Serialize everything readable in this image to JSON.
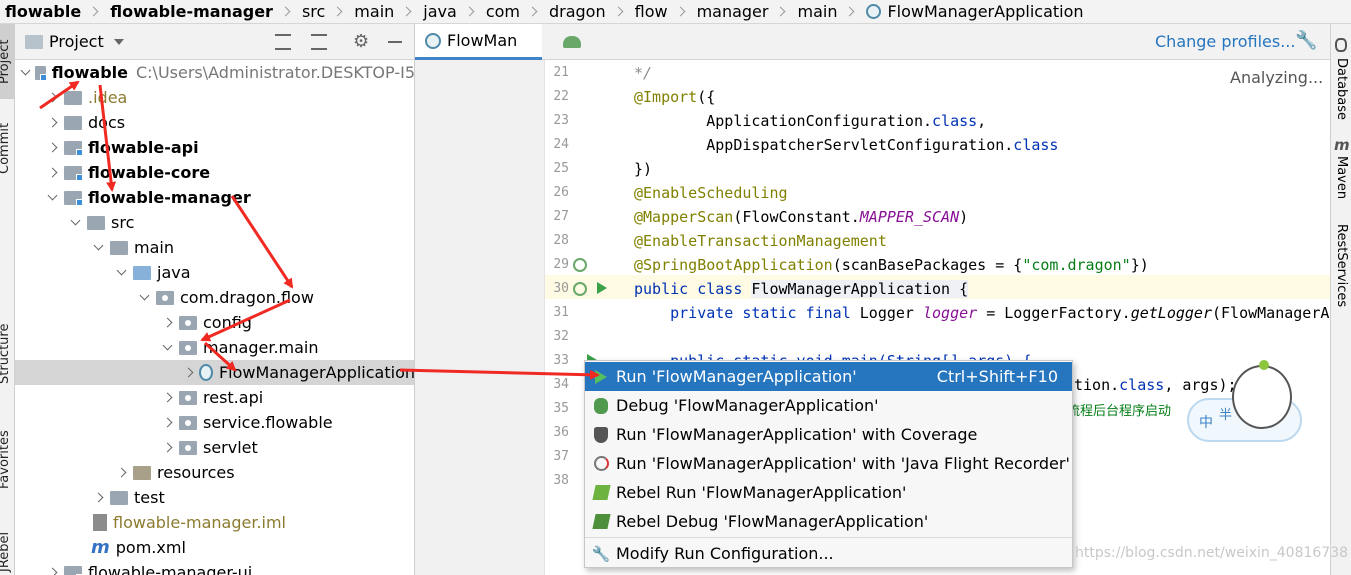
{
  "breadcrumbs": [
    "flowable",
    "flowable-manager",
    "src",
    "main",
    "java",
    "com",
    "dragon",
    "flow",
    "manager",
    "main",
    "FlowManagerApplication"
  ],
  "left_strip": [
    "Project",
    "Commit",
    "Structure",
    "Favorites",
    "JRebel"
  ],
  "right_strip": [
    "Database",
    "Maven",
    "RestServices"
  ],
  "project_panel": {
    "title": "Project",
    "tree": [
      {
        "label": "flowable",
        "hint": "C:\\Users\\Administrator.DESKTOP-I5"
      },
      {
        "label": ".idea"
      },
      {
        "label": "docs"
      },
      {
        "label": "flowable-api"
      },
      {
        "label": "flowable-core"
      },
      {
        "label": "flowable-manager"
      },
      {
        "label": "src"
      },
      {
        "label": "main"
      },
      {
        "label": "java"
      },
      {
        "label": "com.dragon.flow"
      },
      {
        "label": "config"
      },
      {
        "label": "manager.main"
      },
      {
        "label": "FlowManagerApplication"
      },
      {
        "label": "rest.api"
      },
      {
        "label": "service.flowable"
      },
      {
        "label": "servlet"
      },
      {
        "label": "resources"
      },
      {
        "label": "test"
      },
      {
        "label": "flowable-manager.iml"
      },
      {
        "label": "pom.xml"
      },
      {
        "label": "flowable-manager-ui"
      }
    ]
  },
  "editor": {
    "tab": "FlowMan",
    "change_profiles": "Change profiles...",
    "analyzing": "Analyzing...",
    "line_numbers": [
      "21",
      "22",
      "23",
      "24",
      "25",
      "26",
      "27",
      "28",
      "29",
      "30",
      "31",
      "32",
      "33",
      "34",
      "35",
      "36",
      "37",
      "38"
    ],
    "code": {
      "l21": "*/",
      "l22a": "@Import",
      "l22b": "({",
      "l23a": "        ApplicationConfiguration.",
      "l23b": "class",
      "l23c": ",",
      "l24a": "        AppDispatcherServletConfiguration.",
      "l24b": "class",
      "l25": "})",
      "l26": "@EnableScheduling",
      "l27a": "@MapperScan",
      "l27b": "(FlowConstant.",
      "l27c": "MAPPER_SCAN",
      "l27d": ")",
      "l28": "@EnableTransactionManagement",
      "l29a": "@SpringBootApplication",
      "l29b": "(scanBasePackages = {",
      "l29c": "\"com.dragon\"",
      "l29d": "})",
      "l30a": "public class ",
      "l30b": "FlowManagerApplication {",
      "l31a": "    private static final ",
      "l31b": "Logger ",
      "l31c": "logger",
      "l31d": " = LoggerFactory.",
      "l31e": "getLogger",
      "l31f": "(FlowManagerA",
      "l33": "    public static void main(String[] args) {",
      "l34a": "tion.",
      "l34b": "class",
      "l34c": ", args);",
      "l35a": "流程后台程序启动",
      "l35b": "####"
    }
  },
  "context_menu": {
    "items": [
      {
        "label": "Run 'FlowManagerApplication'",
        "shortcut": "Ctrl+Shift+F10"
      },
      {
        "label": "Debug 'FlowManagerApplication'"
      },
      {
        "label": "Run 'FlowManagerApplication' with Coverage"
      },
      {
        "label": "Run 'FlowManagerApplication' with 'Java Flight Recorder'"
      },
      {
        "label": "Rebel Run 'FlowManagerApplication'"
      },
      {
        "label": "Rebel Debug 'FlowManagerApplication'"
      },
      {
        "label": "Modify Run Configuration..."
      }
    ]
  },
  "mascot_text": [
    "中",
    "半"
  ],
  "watermark": "https://blog.csdn.net/weixin_40816738",
  "colors": {
    "accent": "#2675bf",
    "arrow": "#f02a22",
    "selection": "#d5d5d5",
    "keyword": "#0033b3",
    "annotation": "#808000"
  }
}
